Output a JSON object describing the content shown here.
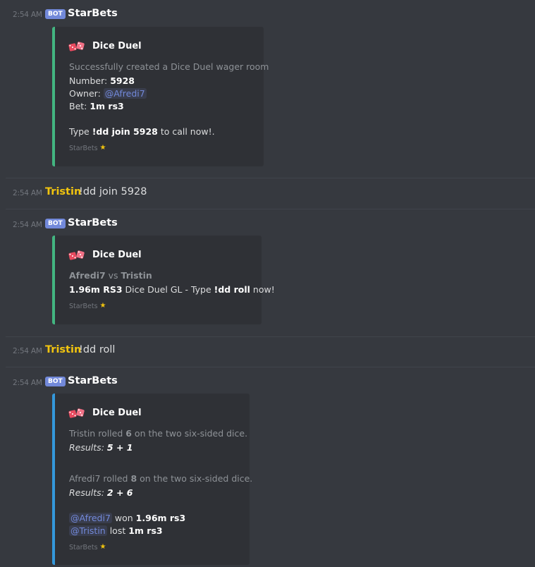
{
  "messages": {
    "m1": {
      "time": "2:54 AM",
      "badge": "BOT",
      "author": "StarBets",
      "embed": {
        "title": "Dice Duel",
        "desc": "Successfully created a Dice Duel wager room",
        "number_label": "Number: ",
        "number_value": "5928",
        "owner_label": "Owner: ",
        "owner_mention": "@Afredi7",
        "bet_label": "Bet: ",
        "bet_value": "1m rs3",
        "type_prefix": "Type ",
        "type_command": "!dd join 5928",
        "type_suffix": " to call now!.",
        "footer": "StarBets"
      }
    },
    "m2": {
      "time": "2:54 AM",
      "author": "Tristin",
      "text": "!dd join 5928"
    },
    "m3": {
      "time": "2:54 AM",
      "badge": "BOT",
      "author": "StarBets",
      "embed": {
        "title": "Dice Duel",
        "player1": "Afredi7",
        "vs": " vs ",
        "player2": "Tristin",
        "pot": "1.96m RS3",
        "pot_text": " Dice Duel GL - Type ",
        "roll_command": "!dd roll",
        "roll_suffix": " now!",
        "footer": "StarBets"
      }
    },
    "m4": {
      "time": "2:54 AM",
      "author": "Tristin",
      "text": "!dd roll"
    },
    "m5": {
      "time": "2:54 AM",
      "badge": "BOT",
      "author": "StarBets",
      "embed": {
        "title": "Dice Duel",
        "r1_name": "Tristin rolled ",
        "r1_total": "6",
        "r1_suffix": " on the two six-sided dice.",
        "r1_results_label": "Results: ",
        "r1_results_value": "5 + 1",
        "r2_name": "Afredi7 rolled ",
        "r2_total": "8",
        "r2_suffix": " on the two six-sided dice.",
        "r2_results_label": "Results: ",
        "r2_results_value": "2 + 6",
        "winner_mention": "@Afredi7",
        "won_text": " won ",
        "won_value": "1.96m rs3",
        "loser_mention": "@Tristin",
        "lost_text": " lost ",
        "lost_value": "1m rs3",
        "footer": "StarBets"
      }
    }
  },
  "colors": {
    "background": "#36393f",
    "embed_bg": "#2f3136",
    "embed_green": "#43b581",
    "embed_blue": "#3498db",
    "bot_badge": "#7289da",
    "username_gold": "#f1c40f"
  },
  "icons": {
    "embed_title": "dice-icon",
    "footer": "star-icon"
  }
}
